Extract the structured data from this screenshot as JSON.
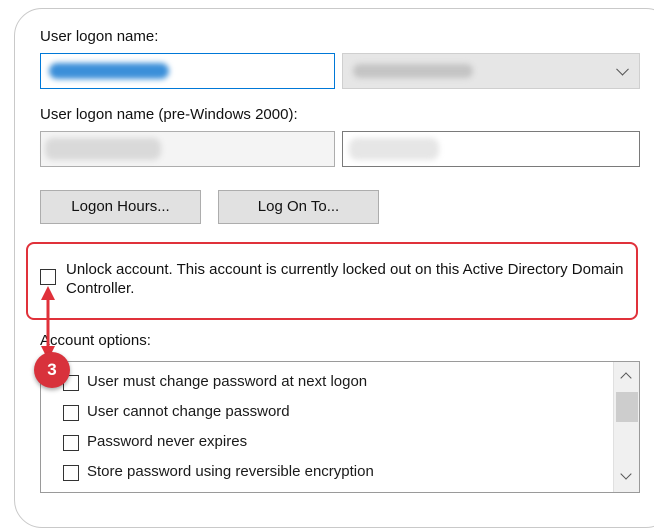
{
  "logon": {
    "user_logon_name_label": "User logon name:",
    "pre2000_label": "User logon name (pre-Windows 2000):"
  },
  "buttons": {
    "logon_hours": "Logon Hours...",
    "log_on_to": "Log On To..."
  },
  "unlock": {
    "text": "Unlock account. This account is currently locked out on this Active Directory Domain Controller.",
    "checked": false
  },
  "account_options": {
    "label": "Account options:",
    "items": [
      {
        "label": "User must change password at next logon",
        "checked": false
      },
      {
        "label": "User cannot change password",
        "checked": false
      },
      {
        "label": "Password never expires",
        "checked": false
      },
      {
        "label": "Store password using reversible encryption",
        "checked": false
      }
    ]
  },
  "annotation": {
    "step_number": "3",
    "color": "#d8323c"
  }
}
